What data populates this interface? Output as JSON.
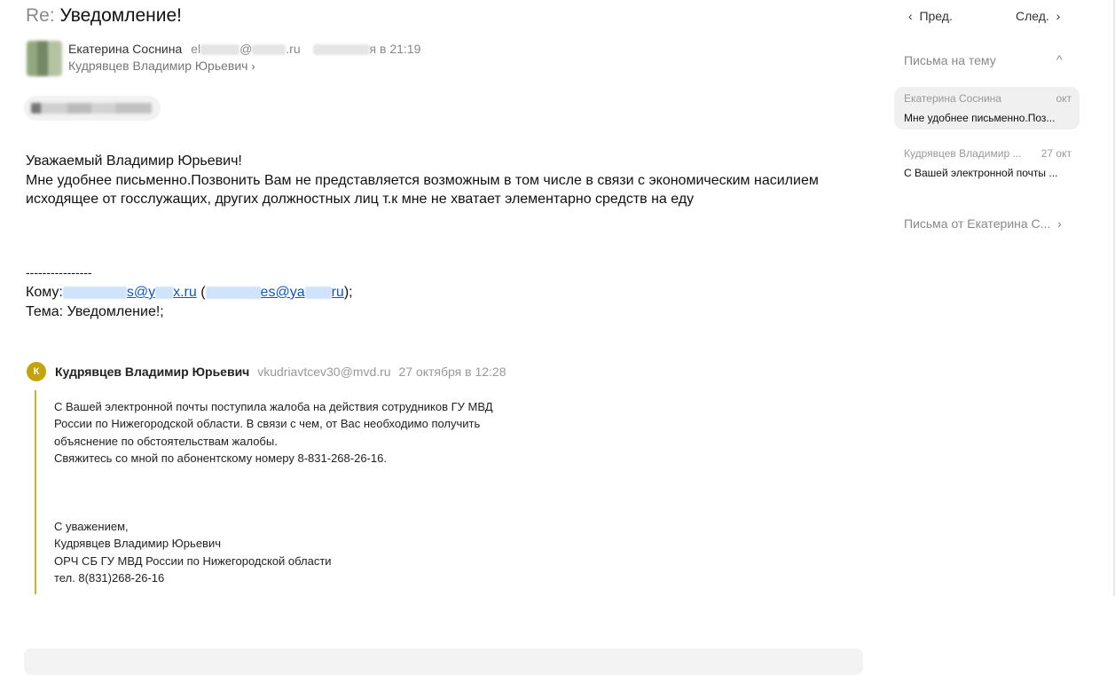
{
  "message": {
    "subject_prefix": "Re:",
    "subject": "Уведомление!",
    "sender_name": "Екатерина Соснина",
    "sender_email_start": "el",
    "sender_email_mid": "@",
    "sender_email_end": ".ru",
    "date_fragment": "я в 21:19",
    "recipient": "Кудрявцев Владимир Юрьевич",
    "body_lines": [
      "Уважаемый Владимир Юрьевич!",
      "Мне удобнее письменно.Позвонить Вам не представляется возможным в том  числе в связи  с экономическим насилием",
      "исходящее от госслужащих, других должностных лиц т.к мне не хватает элементарно средств на еду"
    ],
    "separator": "----------------",
    "to_label": "Кому:",
    "to_link_1": "s@y",
    "to_link_1b": "x.ru",
    "to_paren_open": " (",
    "to_link_2": "es@ya",
    "to_link_2b": "ru",
    "to_close": ");",
    "topic_line": "Тема: Уведомление!;"
  },
  "quoted": {
    "avatar_letter": "К",
    "name": "Кудрявцев Владимир Юрьевич",
    "email": "vkudriavtcev30@mvd.ru",
    "date": "27 октября в 12:28",
    "lines": [
      "С Вашей электронной почты поступила жалоба на действия сотрудников ГУ МВД",
      "России по Нижегородской области. В связи с чем, от Вас необходимо получить",
      "объяснение по обстоятельствам жалобы.",
      "Свяжитесь со мной по абонентскому номеру 8-831-268-26-16."
    ],
    "signature": [
      "С уважением,",
      "Кудрявцев Владимир Юрьевич",
      "ОРЧ СБ ГУ МВД России по Нижегородской области",
      "тел. 8(831)268-26-16"
    ]
  },
  "sidebar": {
    "prev_label": "Пред.",
    "next_label": "След.",
    "thread_title": "Письма на тему",
    "items": [
      {
        "from": "Екатерина Соснина",
        "date": "окт",
        "snippet": "Мне удобнее письменно.Поз..."
      },
      {
        "from": "Кудрявцев Владимир ...",
        "date": "27 окт",
        "snippet": "С Вашей электронной почты ..."
      }
    ],
    "from_link": "Письма от Екатерина С..."
  },
  "colors": {
    "link": "#0b58c4",
    "quote_accent": "#cbb626",
    "avatar_k": "#c5a40b"
  }
}
